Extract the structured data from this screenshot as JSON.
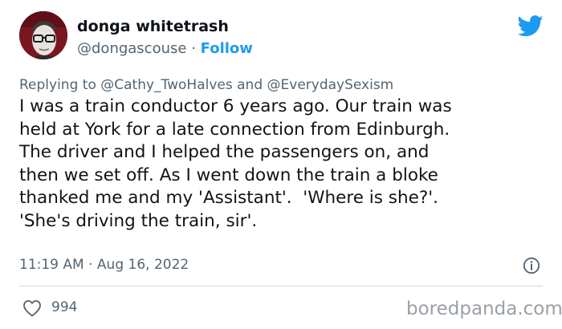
{
  "author": {
    "display_name": "donga whitetrash",
    "handle": "@dongascouse",
    "separator": "·",
    "follow_label": "Follow",
    "avatar_bg": "#7a1620"
  },
  "brand_icon": "twitter-bird-icon",
  "reply": {
    "prefix": "Replying to",
    "mention_1": "@Cathy_TwoHalves",
    "conjunction": "and",
    "mention_2": "@EverydaySexism"
  },
  "tweet": {
    "lines": [
      "I was a train conductor 6 years ago. Our train was",
      "held at York for a late connection from Edinburgh.",
      "The driver and I helped the passengers on, and",
      "then we set off. As I went down the train a bloke",
      "thanked me and my 'Assistant'.  'Where is she?'.",
      "'She's driving the train, sir'."
    ]
  },
  "meta": {
    "time": "11:19 AM",
    "separator": "·",
    "date": "Aug 16, 2022",
    "info_icon": "info-icon"
  },
  "engagement": {
    "likes_icon": "heart-icon",
    "likes_count": "994"
  },
  "watermark": "boredpanda.com",
  "colors": {
    "accent": "#1d9bf0",
    "text": "#0f1419",
    "muted": "#536471",
    "divider": "#cfd9de"
  }
}
